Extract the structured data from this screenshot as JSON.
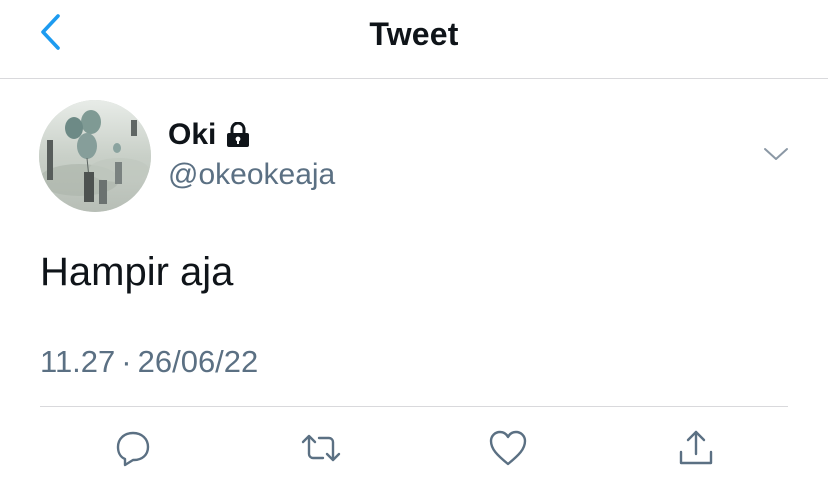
{
  "header": {
    "title": "Tweet",
    "back_icon": "chevron-left-icon"
  },
  "tweet": {
    "author_name": "Oki",
    "author_handle": "@okeokeaja",
    "protected_icon": "lock-icon",
    "text": "Hampir aja",
    "time": "11.27",
    "separator": "·",
    "date": "26/06/22"
  },
  "actions": {
    "icons": [
      "reply-icon",
      "retweet-icon",
      "like-icon",
      "share-icon"
    ]
  },
  "colors": {
    "accent": "#1d9bf0",
    "text_primary": "#0f1419",
    "text_secondary": "#5b7083",
    "divider": "#d9d9dc"
  }
}
